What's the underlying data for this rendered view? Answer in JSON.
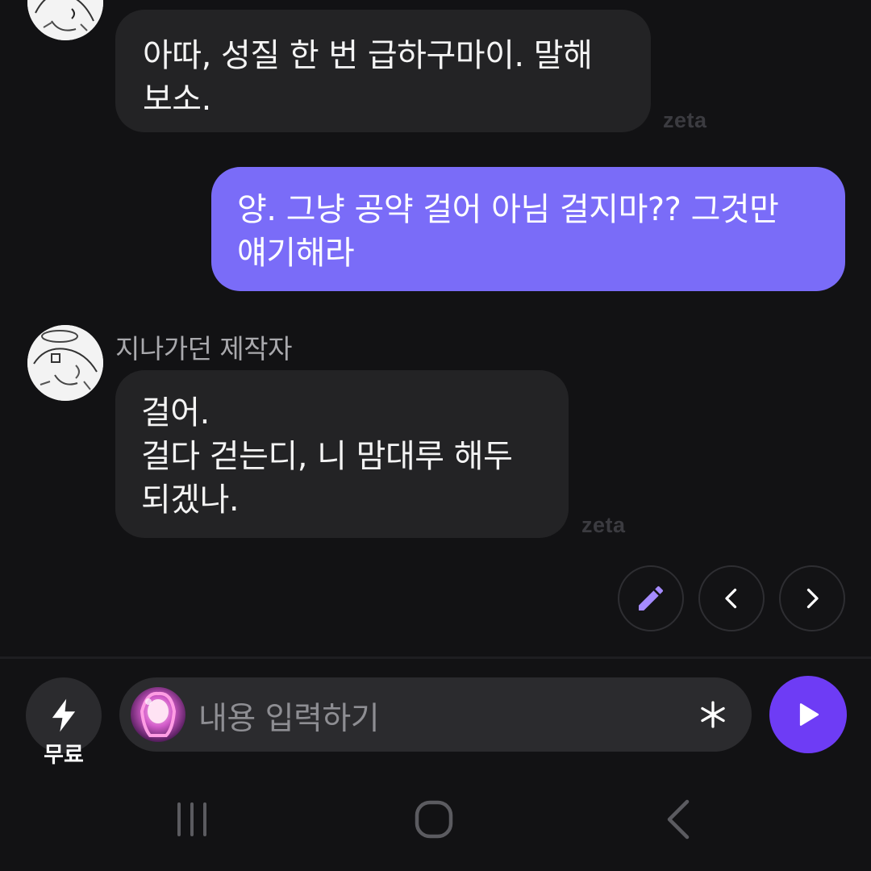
{
  "messages": [
    {
      "sender": "bot",
      "text": "아따, 성질 한 번 급하구마이. 말해\n보소.",
      "watermark": "zeta"
    },
    {
      "sender": "me",
      "text": "양. 그냥 공약 걸어 아님 걸지마?? 그것만\n얘기해라"
    },
    {
      "sender": "bot",
      "name": "지나가던 제작자",
      "text": "걸어.\n걸다 걷는디, 니 맘대루 해두\n되겠나.",
      "watermark": "zeta"
    }
  ],
  "actions": {
    "edit_icon": "pencil-icon",
    "prev_icon": "chevron-left-icon",
    "next_icon": "chevron-right-icon"
  },
  "composer": {
    "boost_label": "무료",
    "placeholder": "내용 입력하기",
    "asterisk": "*"
  },
  "colors": {
    "background": "#121214",
    "bot_bubble": "#232325",
    "user_bubble": "#7a6cf8",
    "send_button": "#6e3cf5",
    "accent_icon": "#a58bff"
  }
}
